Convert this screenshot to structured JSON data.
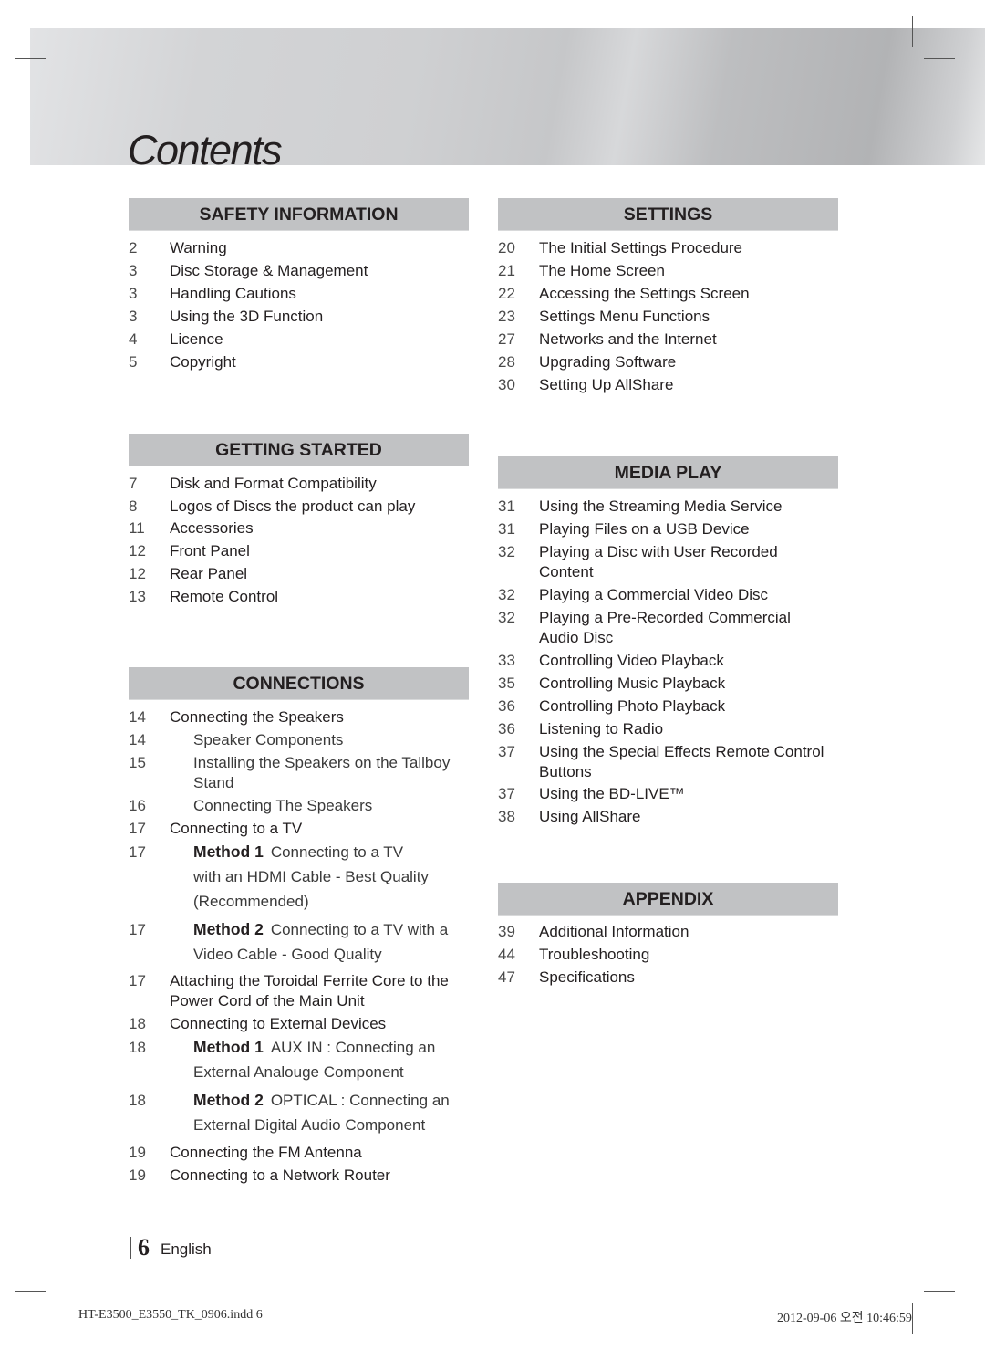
{
  "page": {
    "title": "Contents",
    "page_number": "6",
    "language": "English",
    "slug_file": "HT-E3500_E3550_TK_0906.indd   6",
    "slug_timestamp": "2012-09-06   오전 10:46:59"
  },
  "sections": {
    "safety": {
      "heading": "SAFETY INFORMATION",
      "items": [
        {
          "page": "2",
          "text": "Warning"
        },
        {
          "page": "3",
          "text": "Disc Storage & Management"
        },
        {
          "page": "3",
          "text": "Handling Cautions"
        },
        {
          "page": "3",
          "text": "Using the 3D Function"
        },
        {
          "page": "4",
          "text": "Licence"
        },
        {
          "page": "5",
          "text": "Copyright"
        }
      ]
    },
    "getting_started": {
      "heading": "GETTING STARTED",
      "items": [
        {
          "page": "7",
          "text": "Disk and Format Compatibility"
        },
        {
          "page": "8",
          "text": "Logos of Discs the product can play"
        },
        {
          "page": "11",
          "text": "Accessories"
        },
        {
          "page": "12",
          "text": "Front Panel"
        },
        {
          "page": "12",
          "text": "Rear Panel"
        },
        {
          "page": "13",
          "text": "Remote Control"
        }
      ]
    },
    "connections": {
      "heading": "CONNECTIONS",
      "items": [
        {
          "page": "14",
          "text": "Connecting the Speakers"
        },
        {
          "page": "14",
          "text": "Speaker Components"
        },
        {
          "page": "15",
          "text": "Installing the Speakers on the Tallboy",
          "text2": "Stand"
        },
        {
          "page": "16",
          "text": "Connecting The Speakers"
        },
        {
          "page": "17",
          "text": "Connecting to a TV"
        },
        {
          "page": "17",
          "label": "Method 1",
          "text": "Connecting to a TV",
          "text2": "with an HDMI Cable - Best Quality",
          "text3": "(Recommended)"
        },
        {
          "page": "17",
          "label": "Method 2",
          "text": "Connecting to a TV with a",
          "text2": "Video Cable - Good Quality"
        },
        {
          "page": "17",
          "text": "Attaching the Toroidal Ferrite Core to the",
          "text2": "Power Cord of the Main Unit"
        },
        {
          "page": "18",
          "text": "Connecting to External Devices"
        },
        {
          "page": "18",
          "label": "Method 1",
          "text": "AUX IN : Connecting an",
          "text2": "External Analouge Component"
        },
        {
          "page": "18",
          "label": "Method 2",
          "text": "OPTICAL : Connecting an",
          "text2": "External Digital Audio Component"
        },
        {
          "page": "19",
          "text": "Connecting the FM Antenna"
        },
        {
          "page": "19",
          "text": "Connecting to a Network Router"
        }
      ]
    },
    "settings": {
      "heading": "SETTINGS",
      "items": [
        {
          "page": "20",
          "text": "The Initial Settings Procedure"
        },
        {
          "page": "21",
          "text": "The Home Screen"
        },
        {
          "page": "22",
          "text": "Accessing the Settings Screen"
        },
        {
          "page": "23",
          "text": "Settings Menu Functions"
        },
        {
          "page": "27",
          "text": "Networks and the Internet"
        },
        {
          "page": "28",
          "text": "Upgrading Software"
        },
        {
          "page": "30",
          "text": "Setting Up AllShare"
        }
      ]
    },
    "media_play": {
      "heading": "MEDIA PLAY",
      "items": [
        {
          "page": "31",
          "text": "Using the Streaming Media Service"
        },
        {
          "page": "31",
          "text": "Playing Files on a USB Device"
        },
        {
          "page": "32",
          "text": "Playing a Disc with User Recorded",
          "text2": "Content"
        },
        {
          "page": "32",
          "text": "Playing a Commercial Video Disc"
        },
        {
          "page": "32",
          "text": "Playing a Pre-Recorded Commercial",
          "text2": "Audio Disc"
        },
        {
          "page": "33",
          "text": "Controlling Video Playback"
        },
        {
          "page": "35",
          "text": "Controlling Music Playback"
        },
        {
          "page": "36",
          "text": "Controlling Photo Playback"
        },
        {
          "page": "36",
          "text": "Listening to Radio"
        },
        {
          "page": "37",
          "text": "Using the Special Effects Remote Control",
          "text2": "Buttons"
        },
        {
          "page": "37",
          "text": "Using the BD-LIVE™"
        },
        {
          "page": "38",
          "text": "Using AllShare"
        }
      ]
    },
    "appendix": {
      "heading": "APPENDIX",
      "items": [
        {
          "page": "39",
          "text": "Additional Information"
        },
        {
          "page": "44",
          "text": "Troubleshooting"
        },
        {
          "page": "47",
          "text": "Specifications"
        }
      ]
    }
  }
}
